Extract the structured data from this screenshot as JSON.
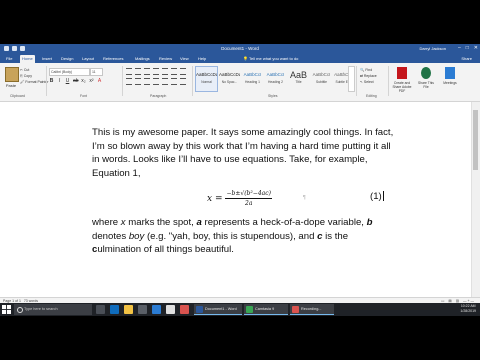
{
  "window": {
    "title": "Document1 - Word",
    "user": "Darryl Jackson"
  },
  "tabs": [
    "File",
    "Home",
    "Insert",
    "Design",
    "Layout",
    "References",
    "Mailings",
    "Review",
    "View",
    "Help"
  ],
  "tell_me": "Tell me what you want to do",
  "share": "Share",
  "ribbon": {
    "paste_label": "Paste",
    "cut": "Cut",
    "copy": "Copy",
    "format_painter": "Format Painter",
    "clipboard_group": "Clipboard",
    "font_name": "Calibri (Body)",
    "font_size": "11",
    "font_group": "Font",
    "paragraph_group": "Paragraph",
    "styles_group": "Styles",
    "editing_group": "Editing",
    "find": "Find",
    "replace": "Replace",
    "select": "Select",
    "styles": [
      {
        "sample": "AaBbCcDd",
        "name": "Normal"
      },
      {
        "sample": "AaBbCcDd",
        "name": "No Spac..."
      },
      {
        "sample": "AaBbCcI",
        "name": "Heading 1"
      },
      {
        "sample": "AaBbCcI",
        "name": "Heading 2"
      },
      {
        "sample": "AaB",
        "name": "Title"
      },
      {
        "sample": "AaBbCcI",
        "name": "Subtitle"
      },
      {
        "sample": "AaBbCcDa",
        "name": "Subtle Em..."
      }
    ],
    "addins": [
      {
        "label": "Create and Share Adobe PDF",
        "color": "#c4161c"
      },
      {
        "label": "Share This File",
        "color": "#217346"
      },
      {
        "label": "Meetings",
        "color": "#2b7cd3"
      }
    ]
  },
  "document": {
    "paragraph1": "This is my awesome paper. It says some amazingly cool things. In fact, I’m so blown away by this work that I’m having a hard time putting it all in words. Looks like I’ll have to use equations. Take, for example, Equation 1,",
    "equation": {
      "lhs": "x",
      "numerator": "−b±√(b²−4ac)",
      "denominator": "2a",
      "number": "(1)"
    },
    "paragraph2": "where x marks the spot, a represents a heck-of-a-dope variable, b denotes boy (e.g. \"yah, boy, this is stupendous), and c is the culmination of all things beautiful."
  },
  "statusbar": {
    "page": "Page 1 of 1",
    "words": "73 words"
  },
  "taskbar": {
    "search_placeholder": "Type here to search",
    "apps": [
      {
        "label": "Document1 - Word",
        "color": "#2b579a"
      },
      {
        "label": "Camtasia 9",
        "color": "#3aa655"
      },
      {
        "label": "Recording...",
        "color": "#d9534f"
      }
    ],
    "time": "10:22 AM",
    "date": "1/28/2019"
  },
  "colors": {
    "word_blue": "#2b579a",
    "taskbar": "#1f2227"
  }
}
